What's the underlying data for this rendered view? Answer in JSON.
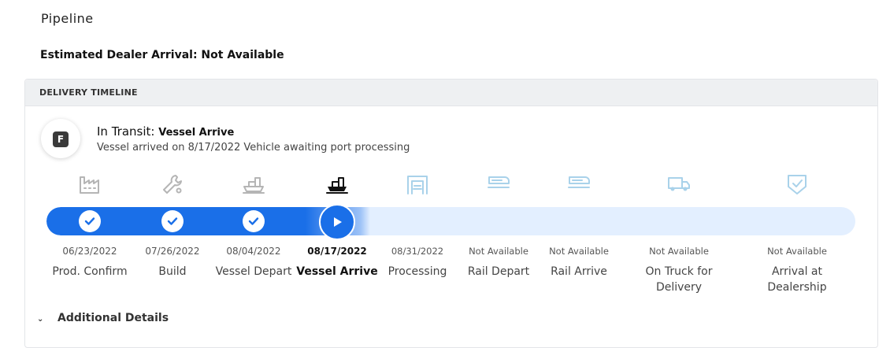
{
  "page": {
    "title": "Pipeline",
    "eta_label": "Estimated Dealer Arrival: Not Available"
  },
  "card": {
    "header": "DELIVERY TIMELINE",
    "avatar_letter": "F",
    "status_prefix": "In Transit:",
    "status_stage": "Vessel Arrive",
    "status_desc": "Vessel arrived on 8/17/2022 Vehicle awaiting port processing"
  },
  "timeline": {
    "progress_percent": 40,
    "stages": [
      {
        "date": "06/23/2022",
        "label": "Prod. Confirm",
        "state": "done",
        "icon": "factory-icon"
      },
      {
        "date": "07/26/2022",
        "label": "Build",
        "state": "done",
        "icon": "wrench-icon"
      },
      {
        "date": "08/04/2022",
        "label": "Vessel Depart",
        "state": "done",
        "icon": "ship-icon"
      },
      {
        "date": "08/17/2022",
        "label": "Vessel Arrive",
        "state": "current",
        "icon": "ship-icon"
      },
      {
        "date": "08/31/2022",
        "label": "Processing",
        "state": "future",
        "icon": "garage-icon"
      },
      {
        "date": "Not Available",
        "label": "Rail Depart",
        "state": "future",
        "icon": "train-icon"
      },
      {
        "date": "Not Available",
        "label": "Rail Arrive",
        "state": "future",
        "icon": "train-icon"
      },
      {
        "date": "Not Available",
        "label": "On Truck for Delivery",
        "state": "future",
        "icon": "truck-icon"
      },
      {
        "date": "Not Available",
        "label": "Arrival at Dealership",
        "state": "future",
        "icon": "shield-check-icon"
      }
    ]
  },
  "details": {
    "label": "Additional Details"
  },
  "colors": {
    "accent": "#1a6fe8",
    "track": "#e3efff",
    "icon_done": "#b5b5b5",
    "icon_current": "#111111",
    "icon_future": "#a9d2ea"
  }
}
